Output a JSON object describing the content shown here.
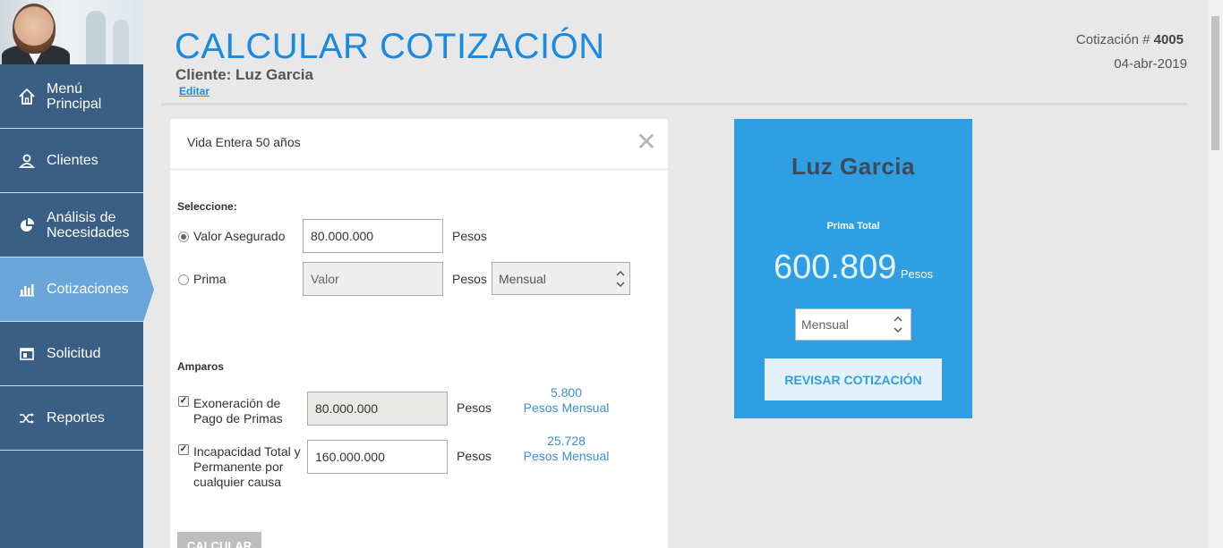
{
  "sidebar": {
    "items": [
      {
        "label": "Menú Principal",
        "icon": "home-icon"
      },
      {
        "label": "Clientes",
        "icon": "user-icon"
      },
      {
        "label": "Análisis de Necesidades",
        "icon": "pie-chart-icon"
      },
      {
        "label": "Cotizaciones",
        "icon": "bar-chart-icon",
        "active": true
      },
      {
        "label": "Solicitud",
        "icon": "form-icon"
      },
      {
        "label": "Reportes",
        "icon": "shuffle-icon"
      }
    ]
  },
  "header": {
    "title": "CALCULAR COTIZACIÓN",
    "client": "Cliente: Luz Garcia",
    "edit": "Editar",
    "quote_label": "Cotización #",
    "quote_number": "4005",
    "date": "04-abr-2019"
  },
  "card": {
    "title": "Vida Entera 50 años",
    "select_label": "Seleccione:",
    "option_insured": {
      "label": "Valor Asegurado",
      "value": "80.000.000",
      "unit": "Pesos",
      "selected": true
    },
    "option_premium": {
      "label": "Prima",
      "placeholder": "Valor",
      "unit": "Pesos",
      "frequency": "Mensual",
      "selected": false
    },
    "amparos_label": "Amparos",
    "amparos": [
      {
        "label": "Exoneración de Pago de Primas",
        "value": "80.000.000",
        "unit": "Pesos",
        "premium": "5.800",
        "premium_unit": "Pesos Mensual",
        "checked": true
      },
      {
        "label": "Incapacidad Total y Permanente por cualquier causa",
        "value": "160.000.000",
        "unit": "Pesos",
        "premium": "25.728",
        "premium_unit": "Pesos Mensual",
        "checked": true
      }
    ],
    "calc_button": "CALCULAR"
  },
  "summary": {
    "name": "Luz Garcia",
    "label": "Prima Total",
    "value": "600.809",
    "unit": "Pesos",
    "frequency": "Mensual",
    "button": "REVISAR COTIZACIÓN"
  },
  "colors": {
    "sidebar": "#3b5f84",
    "active": "#6aa6d9",
    "accent": "#1a8be0",
    "summary_bg": "#2f9fe3"
  }
}
